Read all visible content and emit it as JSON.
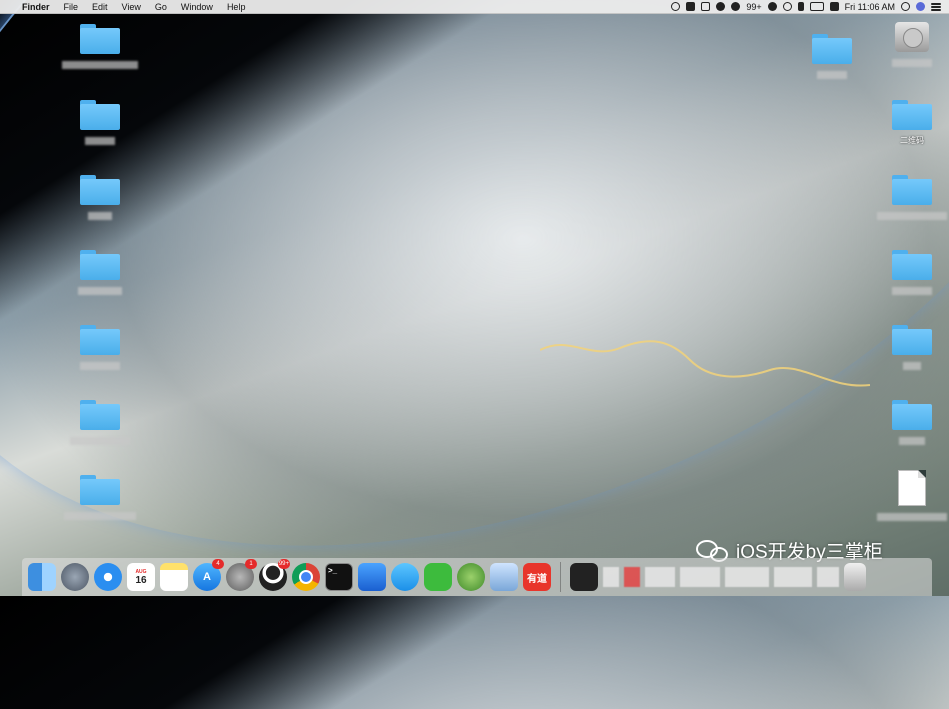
{
  "menubar": {
    "app": "Finder",
    "menus": [
      "File",
      "Edit",
      "View",
      "Go",
      "Window",
      "Help"
    ],
    "status": {
      "notification_badge": "99+",
      "clock": "Fri 11:06 AM"
    }
  },
  "desktop": {
    "right_labels": {
      "qrcode_folder": "二维码"
    }
  },
  "dock": {
    "calendar": {
      "month": "AUG",
      "day": "16"
    },
    "badges": {
      "app_store": "4",
      "system_prefs": "1",
      "qq": "99+"
    },
    "youdao_label": "有道"
  },
  "watermark": {
    "text": "iOS开发by三掌柜"
  },
  "colors": {
    "folder": "#5bbcf5",
    "badge": "#e52b2b",
    "chrome_red": "#db4437"
  }
}
